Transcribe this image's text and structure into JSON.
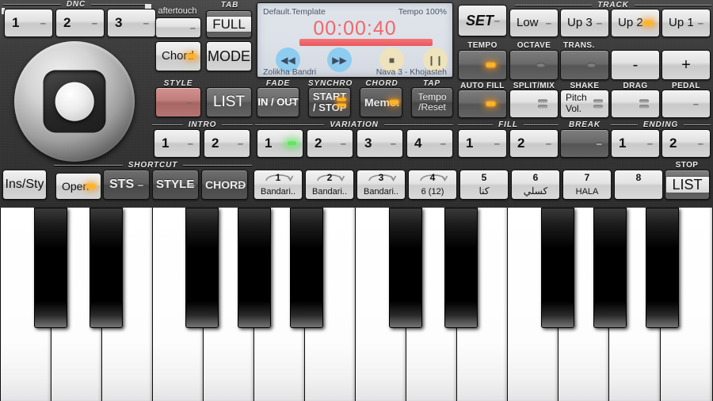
{
  "sections": {
    "dnc": "DNC",
    "tab": "TAB",
    "style": "STYLE",
    "fade": "FADE",
    "synchro": "SYNCHRO",
    "chord": "CHORD",
    "tap": "TAP",
    "intro": "INTRO",
    "variation": "VARIATION",
    "fill": "FILL",
    "break": "BREAK",
    "ending": "ENDING",
    "track": "TRACK",
    "tempo": "TEMPO",
    "octave": "OCTAVE",
    "trans": "TRANS.",
    "auto_fill": "AUTO FILL",
    "split_mix": "SPLIT/MIX",
    "shake": "SHAKE",
    "drag": "DRAG",
    "pedal": "PEDAL",
    "shortcut": "SHORTCUT",
    "stop": "STOP",
    "aftertouch": "aftertouch"
  },
  "dnc_buttons": [
    {
      "label": "1",
      "led": "off"
    },
    {
      "label": "2",
      "led": "off"
    },
    {
      "label": "3",
      "led": "off"
    }
  ],
  "left_column": {
    "aftertouch_button": {
      "label": "",
      "led": "off"
    },
    "chord_button": {
      "label": "Chord",
      "led": "amber"
    },
    "style_button": {
      "label": "",
      "led": "off"
    }
  },
  "tab_column": {
    "full_button": "FULL",
    "mode_button": "MODE",
    "list_button": "LIST"
  },
  "lcd": {
    "template": "Default.Template",
    "tempo": "Tempo 100%",
    "time": "00:00:40",
    "artist": "Zolikha Bandri",
    "song": "Nava 3 - Khojasteh",
    "progress_percent": 100,
    "transport": [
      {
        "name": "rewind-button",
        "glyph": "◀◀",
        "style": "blue"
      },
      {
        "name": "forward-button",
        "glyph": "▶▶",
        "style": "blue"
      },
      {
        "name": "stop-button",
        "glyph": "■",
        "style": "tan"
      },
      {
        "name": "pause-button",
        "glyph": "❙❙",
        "style": "tan"
      }
    ]
  },
  "style_row": {
    "list_button": "LIST",
    "fade_button": "IN / OUT",
    "synchro_button": "START\n/ STOP",
    "chord_button": "Memo.",
    "tap_button": "Tempo\n/Reset"
  },
  "intro_buttons": [
    {
      "label": "1",
      "led": "dash"
    },
    {
      "label": "2",
      "led": "dash"
    }
  ],
  "variation_buttons": [
    {
      "label": "1",
      "led": "green"
    },
    {
      "label": "2",
      "led": "dash"
    },
    {
      "label": "3",
      "led": "dash"
    },
    {
      "label": "4",
      "led": "dash"
    }
  ],
  "fill_buttons": [
    {
      "label": "1",
      "led": "dash"
    },
    {
      "label": "2",
      "led": "dash"
    }
  ],
  "break_button": {
    "label": "",
    "led": "dash"
  },
  "ending_buttons": [
    {
      "label": "1",
      "led": "dash"
    },
    {
      "label": "2",
      "led": "dash"
    }
  ],
  "track": {
    "set_button": {
      "label": "SET",
      "led": "dash"
    },
    "buttons": [
      {
        "label": "Low",
        "led": "dash"
      },
      {
        "label": "Up 3",
        "led": "dash"
      },
      {
        "label": "Up 2",
        "led": "amber"
      },
      {
        "label": "Up 1",
        "led": "dash"
      }
    ]
  },
  "param_row": {
    "tempo_button": {
      "label": "",
      "led": "amber"
    },
    "octave_button": {
      "label": "",
      "led": "oval"
    },
    "trans_button": {
      "label": "",
      "led": "oval"
    },
    "minus_button": "-",
    "plus_button": "+"
  },
  "mix_row": {
    "auto_fill": {
      "label": "",
      "led": "amber"
    },
    "split_mix": {
      "label": "",
      "led": "double"
    },
    "shake": {
      "label": "Pitch\nVol.",
      "led": "double"
    },
    "drag": {
      "label": "",
      "led": "double"
    },
    "pedal": {
      "label": "",
      "led": "dash"
    }
  },
  "shortcut_row": {
    "ins_sty_button": "Ins/Sty",
    "open_button": {
      "label": "Open",
      "led": "amber"
    },
    "sts_button": {
      "label": "STS",
      "led": "dash"
    },
    "style_button": {
      "label": "STYLE",
      "led": "dash"
    },
    "chord_button": {
      "label": "CHORD",
      "led": "dash"
    },
    "stop_list_button": "LIST"
  },
  "pads": [
    {
      "num": "1",
      "name": "Bandari..",
      "loop": true
    },
    {
      "num": "2",
      "name": "Bandari..",
      "loop": true
    },
    {
      "num": "3",
      "name": "Bandari..",
      "loop": true
    },
    {
      "num": "4",
      "name": "6 (12)",
      "loop": true
    },
    {
      "num": "5",
      "name": "كنا",
      "loop": false,
      "rtl": true
    },
    {
      "num": "6",
      "name": "كسلي",
      "loop": false,
      "rtl": true
    },
    {
      "num": "7",
      "name": "HALA",
      "loop": false
    },
    {
      "num": "8",
      "name": "",
      "loop": false
    }
  ],
  "keyboard": {
    "white_key_count": 14,
    "black_key_indices": [
      0,
      1,
      3,
      4,
      5,
      7,
      8,
      10,
      11
    ],
    "octave_pattern": "C D E F G A B"
  },
  "colors": {
    "panel": "#3b3b3b",
    "lcd_bg": "#dde2e9",
    "accent_red": "#f0676b",
    "led_amber": "#ffb524",
    "led_green": "#63e463",
    "style_red": "#c07f7d"
  }
}
